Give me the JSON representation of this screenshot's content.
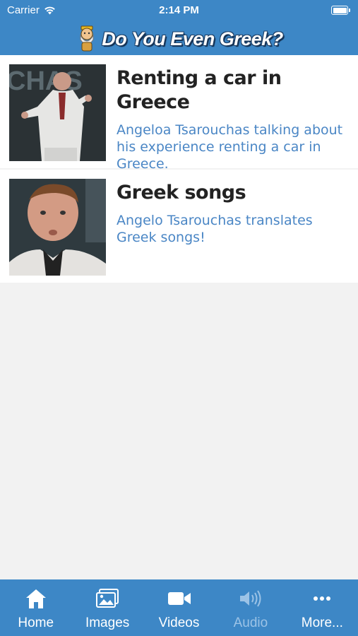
{
  "status_bar": {
    "carrier": "Carrier",
    "time": "2:14 PM",
    "battery_level": 1.0
  },
  "header": {
    "title": "Do You Even Greek?"
  },
  "items": [
    {
      "title": "Renting a car in Greece",
      "description": "Angeloa Tsarouchas talking about his experience renting a car in Greece.",
      "thumb_text": "CHAS"
    },
    {
      "title": "Greek songs",
      "description": "Angelo Tsarouchas translates Greek songs!"
    }
  ],
  "tabs": [
    {
      "label": "Home",
      "icon": "home-icon",
      "enabled": true
    },
    {
      "label": "Images",
      "icon": "images-icon",
      "enabled": true
    },
    {
      "label": "Videos",
      "icon": "video-camera-icon",
      "enabled": true
    },
    {
      "label": "Audio",
      "icon": "speaker-icon",
      "enabled": false
    },
    {
      "label": "More...",
      "icon": "more-icon",
      "enabled": true
    }
  ],
  "colors": {
    "accent": "#3d87c6",
    "link": "#4a86c5",
    "disabled_tab": "#9cc3e6"
  }
}
